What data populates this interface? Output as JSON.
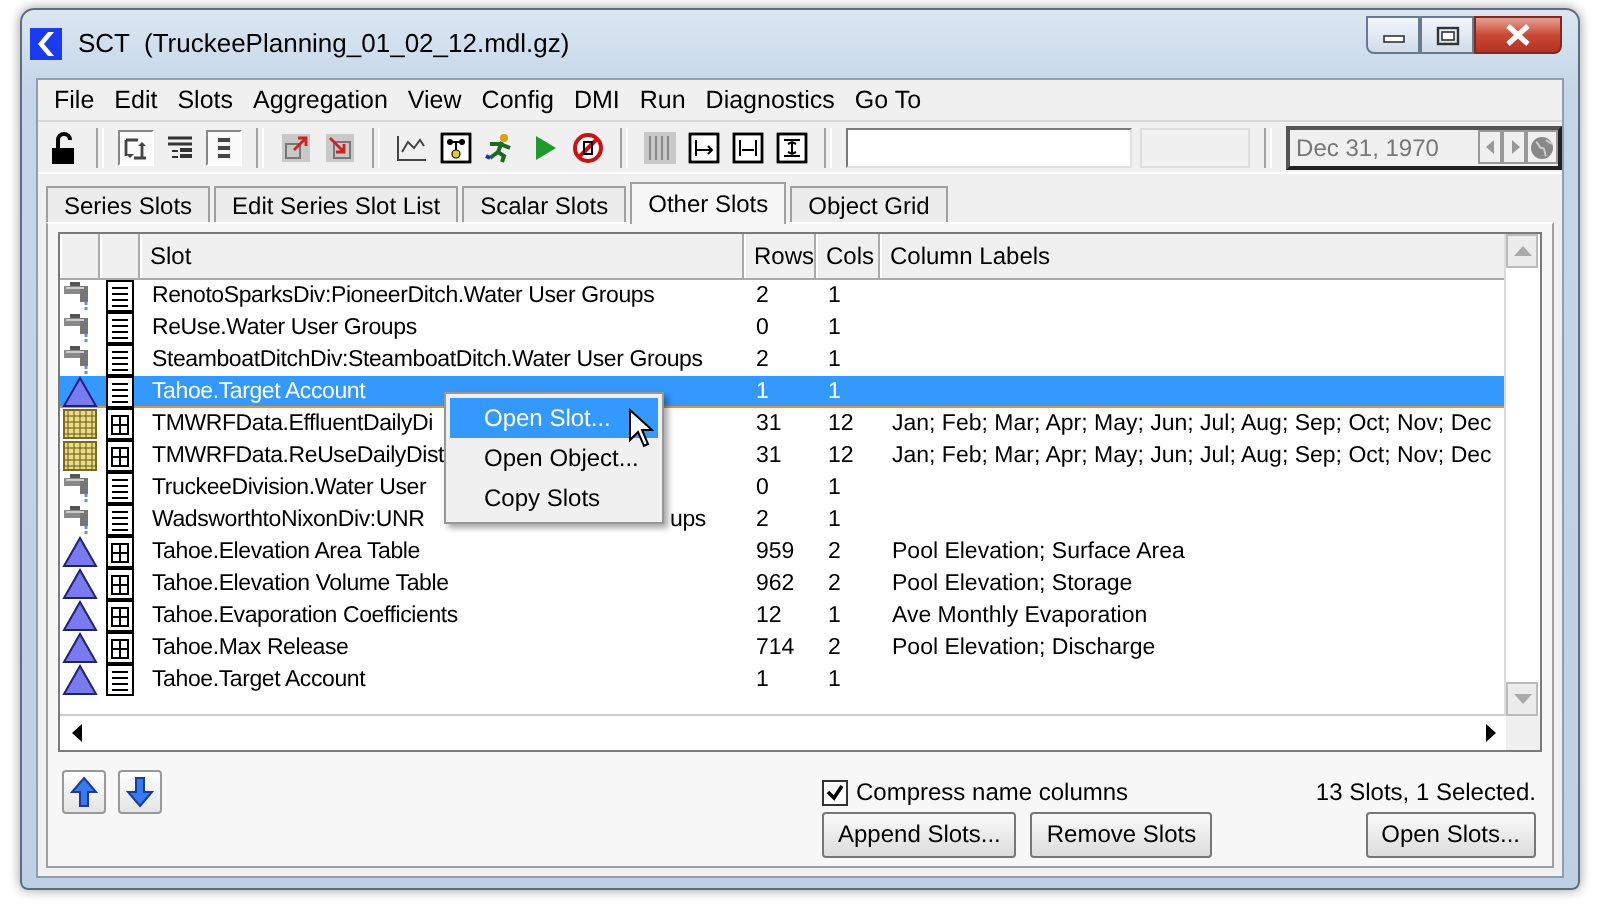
{
  "window": {
    "title": "SCT  (TruckeePlanning_01_02_12.mdl.gz)"
  },
  "menu": [
    "File",
    "Edit",
    "Slots",
    "Aggregation",
    "View",
    "Config",
    "DMI",
    "Run",
    "Diagnostics",
    "Go To"
  ],
  "toolbar": {
    "toggles": [
      {
        "pressed": true
      },
      {
        "pressed": false
      },
      {
        "pressed": true
      }
    ],
    "date_field": {
      "value": "Dec 31, 1970"
    }
  },
  "tabs": [
    {
      "label": "Series Slots",
      "selected": false
    },
    {
      "label": "Edit Series Slot List",
      "selected": false
    },
    {
      "label": "Scalar Slots",
      "selected": false
    },
    {
      "label": "Other Slots",
      "selected": true
    },
    {
      "label": "Object Grid",
      "selected": false
    }
  ],
  "table": {
    "columns": [
      "Slot",
      "Rows",
      "Cols",
      "Column Labels"
    ],
    "rows": [
      {
        "object_icon": {
          "kind": "diversion"
        },
        "slot_icon": {
          "kind": "list"
        },
        "slot": "RenotoSparksDiv:PioneerDitch.Water User Groups",
        "rows": "2",
        "cols": "1",
        "selected": false
      },
      {
        "object_icon": {
          "kind": "diversion"
        },
        "slot_icon": {
          "kind": "list"
        },
        "slot": "ReUse.Water User Groups",
        "rows": "0",
        "cols": "1",
        "selected": false
      },
      {
        "object_icon": {
          "kind": "diversion"
        },
        "slot_icon": {
          "kind": "list"
        },
        "slot": "SteamboatDitchDiv:SteamboatDitch.Water User Groups",
        "rows": "2",
        "cols": "1",
        "selected": false
      },
      {
        "object_icon": {
          "kind": "reservoir"
        },
        "slot_icon": {
          "kind": "list"
        },
        "slot": "Tahoe.Target Account",
        "rows": "1",
        "cols": "1",
        "selected": true
      },
      {
        "object_icon": {
          "kind": "data"
        },
        "slot_icon": {
          "kind": "table"
        },
        "slot": "TMWRFData.EffluentDailyDi",
        "rows": "31",
        "cols": "12",
        "column_labels": "Jan; Feb; Mar; Apr; May; Jun; Jul; Aug; Sep; Oct; Nov; Dec",
        "selected": false
      },
      {
        "object_icon": {
          "kind": "data"
        },
        "slot_icon": {
          "kind": "table"
        },
        "slot": "TMWRFData.ReUseDailyDist",
        "rows": "31",
        "cols": "12",
        "column_labels": "Jan; Feb; Mar; Apr; May; Jun; Jul; Aug; Sep; Oct; Nov; Dec",
        "selected": false
      },
      {
        "object_icon": {
          "kind": "diversion"
        },
        "slot_icon": {
          "kind": "list"
        },
        "slot": "TruckeeDivision.Water User",
        "rows": "0",
        "cols": "1",
        "selected": false
      },
      {
        "object_icon": {
          "kind": "diversion"
        },
        "slot_icon": {
          "kind": "list"
        },
        "slot": "WadsworthtoNixonDiv:UNR",
        "slot_tail": "ups",
        "rows": "2",
        "cols": "1",
        "selected": false
      },
      {
        "object_icon": {
          "kind": "reservoir"
        },
        "slot_icon": {
          "kind": "table"
        },
        "slot": "Tahoe.Elevation Area Table",
        "rows": "959",
        "cols": "2",
        "column_labels": "Pool Elevation; Surface Area",
        "selected": false
      },
      {
        "object_icon": {
          "kind": "reservoir"
        },
        "slot_icon": {
          "kind": "table"
        },
        "slot": "Tahoe.Elevation Volume Table",
        "rows": "962",
        "cols": "2",
        "column_labels": "Pool Elevation; Storage",
        "selected": false
      },
      {
        "object_icon": {
          "kind": "reservoir"
        },
        "slot_icon": {
          "kind": "table"
        },
        "slot": "Tahoe.Evaporation Coefficients",
        "rows": "12",
        "cols": "1",
        "column_labels": "Ave Monthly Evaporation",
        "selected": false
      },
      {
        "object_icon": {
          "kind": "reservoir"
        },
        "slot_icon": {
          "kind": "table"
        },
        "slot": "Tahoe.Max Release",
        "rows": "714",
        "cols": "2",
        "column_labels": "Pool Elevation; Discharge",
        "selected": false
      },
      {
        "object_icon": {
          "kind": "reservoir"
        },
        "slot_icon": {
          "kind": "list"
        },
        "slot": "Tahoe.Target Account",
        "rows": "1",
        "cols": "1",
        "selected": false
      }
    ]
  },
  "context_menu": {
    "items": [
      {
        "label": "Open Slot...",
        "selected": true
      },
      {
        "label": "Open Object...",
        "selected": false
      },
      {
        "label": "Copy Slots",
        "selected": false
      }
    ]
  },
  "footer": {
    "compress": {
      "label": "Compress name columns",
      "checked": true
    },
    "status": "13 Slots, 1 Selected.",
    "buttons": [
      "Append Slots...",
      "Remove Slots",
      "Open Slots..."
    ]
  }
}
